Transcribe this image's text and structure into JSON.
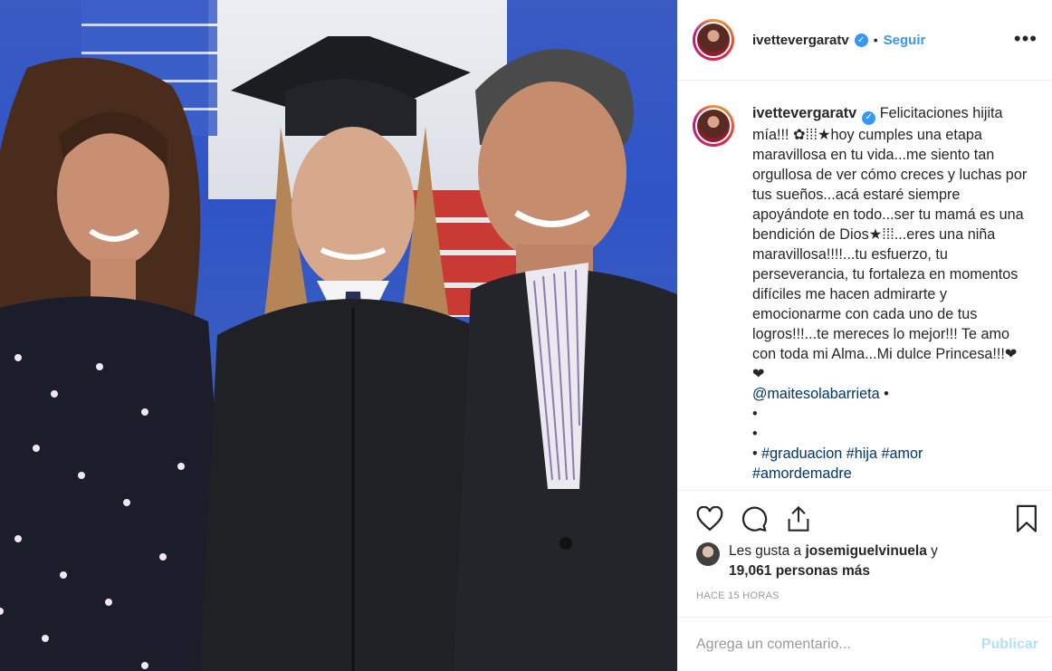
{
  "post": {
    "username": "ivettevergaratv",
    "separator": "•",
    "follow_label": "Seguir",
    "more_label": "•••",
    "caption": {
      "username": "ivettevergaratv",
      "line1": "Felicitaciones hijita mía!!! ✿⁞⁞⁞",
      "line2": "hoy cumples una etapa maravillosa en tu vida...me siento tan orgullosa de ver cómo creces y luchas por tus sueños...acá estaré siempre apoyándote en todo...ser tu mamá es una bendición de Dios",
      "line3": "...eres una niña maravillosa!!!!...tu esfuerzo, tu perseverancia, tu fortaleza en momentos difíciles me hacen admirarte y emocionarme con cada uno de tus logros!!!...te mereces lo mejor!!! Te amo con toda mi Alma...Mi dulce Princesa!!!",
      "hearts": "❤❤",
      "star": "★",
      "glyphs": "⁞⁞⁞",
      "mention": "@maitesolabarrieta",
      "bullet": "•",
      "tags": [
        "#graduacion",
        "#hija",
        "#amor",
        "#amordemadre"
      ]
    },
    "likes": {
      "prefix": "Les gusta a",
      "liker": "josemiguelvinuela",
      "connector": "y",
      "count": "19,061 personas más"
    },
    "time_ago": "HACE 15 HORAS",
    "comment": {
      "placeholder": "Agrega un comentario...",
      "publish_label": "Publicar"
    }
  },
  "icons": {
    "like": "heart-icon",
    "comment": "comment-icon",
    "share": "share-icon",
    "save": "bookmark-icon",
    "verified": "verified-badge-icon"
  },
  "colors": {
    "link_blue": "#3897f0",
    "tag_blue": "#003569",
    "muted": "#999999",
    "publish_disabled": "#b2dffc"
  }
}
